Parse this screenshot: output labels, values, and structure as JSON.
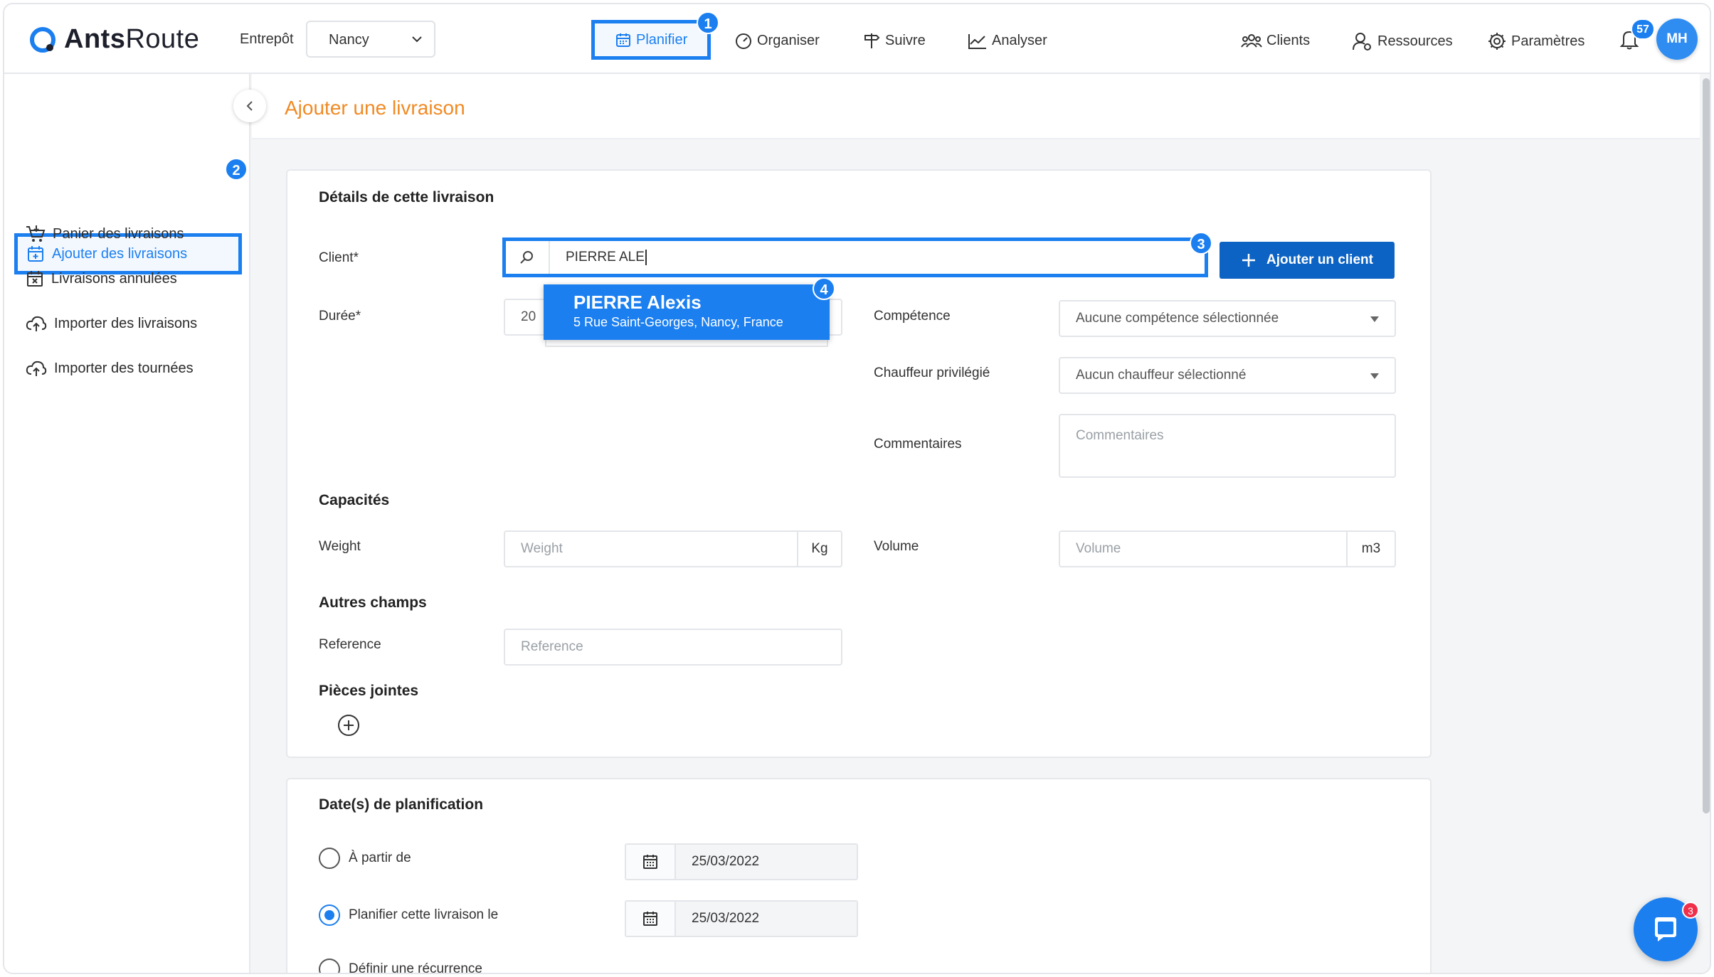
{
  "app": {
    "logo_text_bold": "Ants",
    "logo_text_light": "Route"
  },
  "topnav": {
    "entrepot_label": "Entrepôt",
    "entrepot_value": "Nancy",
    "items": [
      {
        "label": "Planifier",
        "step": "1"
      },
      {
        "label": "Organiser"
      },
      {
        "label": "Suivre"
      },
      {
        "label": "Analyser"
      },
      {
        "label": "Clients"
      },
      {
        "label": "Ressources"
      },
      {
        "label": "Paramètres"
      }
    ],
    "notifications_count": "57",
    "avatar_initials": "MH"
  },
  "sidebar": {
    "active_step": "2",
    "items": [
      {
        "label": "Ajouter des livraisons"
      },
      {
        "label": "Panier des livraisons"
      },
      {
        "label": "Livraisons annulées"
      },
      {
        "label": "Importer des livraisons"
      },
      {
        "label": "Importer des tournées"
      }
    ]
  },
  "page": {
    "title": "Ajouter une livraison"
  },
  "details": {
    "section_title": "Détails de cette livraison",
    "client_label": "Client*",
    "client_value": "PIERRE ALE",
    "client_step": "3",
    "add_client_label": "Ajouter un client",
    "suggestion": {
      "step": "4",
      "name": "PIERRE Alexis",
      "address": "5 Rue Saint-Georges, Nancy, France"
    },
    "duree_label": "Durée*",
    "duree_value": "20",
    "competence_label": "Compétence",
    "competence_value": "Aucune compétence sélectionnée",
    "chauffeur_label": "Chauffeur privilégié",
    "chauffeur_value": "Aucun chauffeur sélectionné",
    "commentaires_label": "Commentaires",
    "commentaires_placeholder": "Commentaires",
    "capacites_title": "Capacités",
    "weight_label": "Weight",
    "weight_placeholder": "Weight",
    "weight_unit": "Kg",
    "volume_label": "Volume",
    "volume_placeholder": "Volume",
    "volume_unit": "m3",
    "autres_title": "Autres champs",
    "reference_label": "Reference",
    "reference_placeholder": "Reference",
    "pieces_title": "Pièces jointes"
  },
  "planning": {
    "section_title": "Date(s) de planification",
    "options": [
      {
        "label": "À partir de",
        "date": "25/03/2022",
        "checked": false
      },
      {
        "label": "Planifier cette livraison le",
        "date": "25/03/2022",
        "checked": true
      },
      {
        "label": "Définir une récurrence",
        "checked": false
      }
    ]
  },
  "chat": {
    "unread": "3"
  },
  "colors": {
    "accent": "#1b7ff0",
    "title_orange": "#f08a24",
    "button_blue": "#0c63c4"
  }
}
